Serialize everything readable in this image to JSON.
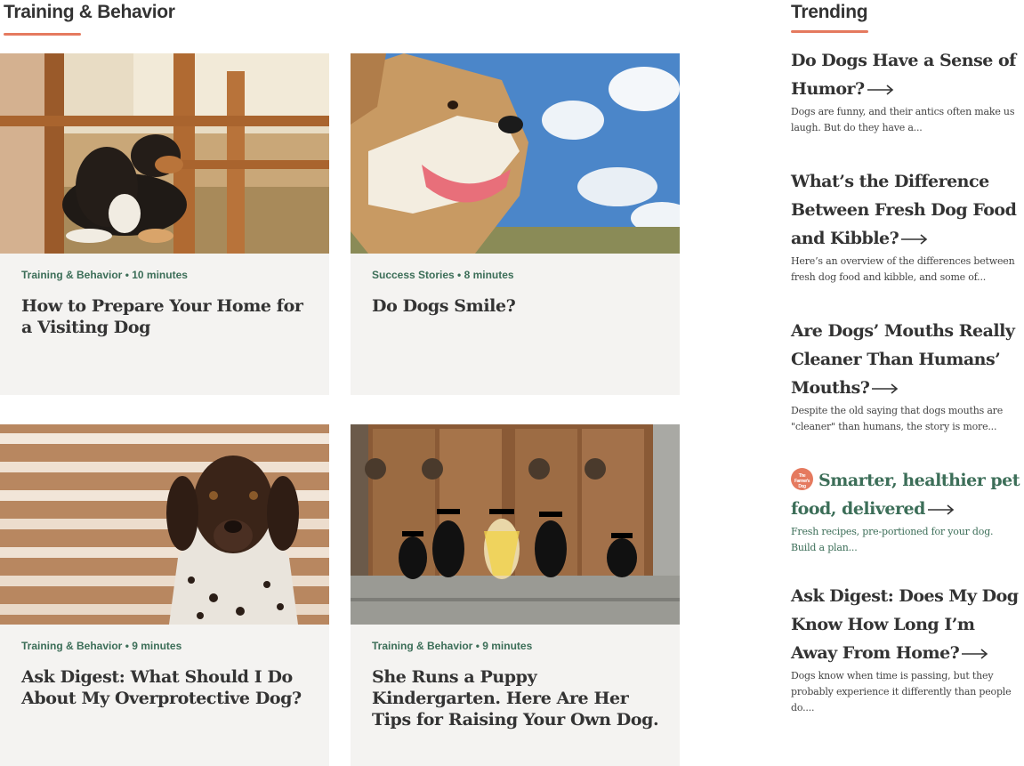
{
  "section": {
    "title": "Training & Behavior"
  },
  "colors": {
    "accent_underline": "#e57a5f",
    "category_green": "#3c6e58",
    "card_bg": "#f4f3f1",
    "heading_text": "#333333"
  },
  "cards": [
    {
      "meta": "Training & Behavior • 10 minutes",
      "headline": "How to Prepare Your Home for a Visiting Dog",
      "image": "tricolor dog lying under wooden chairs"
    },
    {
      "meta": "Success Stories • 8 minutes",
      "headline": "Do Dogs Smile?",
      "image": "terrier smiling under blue sky"
    },
    {
      "meta": "Training & Behavior • 9 minutes",
      "headline": "Ask Digest: What Should I Do About My Overprotective Dog?",
      "image": "spotted pointer in front of wooden slats"
    },
    {
      "meta": "Training & Behavior • 9 minutes",
      "headline": "She Runs a Puppy Kindergarten. Here Are Her Tips for Raising Your Own Dog.",
      "image": "puppies in graduation caps on steps"
    }
  ],
  "trending": {
    "title": "Trending",
    "items": [
      {
        "headline": "Do Dogs Have a Sense of Humor?",
        "description": "Dogs are funny, and their antics often make us laugh. But do they have a...",
        "icon": "arrow-right-icon"
      },
      {
        "headline": "What’s the Difference Between Fresh Dog Food and Kibble?",
        "description": "Here’s an overview of the differences between fresh dog food and kibble, and some of...",
        "icon": "arrow-right-icon"
      },
      {
        "headline": "Are Dogs’ Mouths Really Cleaner Than Humans’ Mouths?",
        "description": "Despite the old saying that dogs mouths are \"cleaner\" than humans, the story is more...",
        "icon": "arrow-right-icon"
      },
      {
        "headline": "Smarter, healthier pet food, delivered",
        "description": "Fresh recipes, pre-portioned for your dog. Build a plan...",
        "logo_text": "The Farmer's Dog",
        "icon": "arrow-right-icon"
      },
      {
        "headline": "Ask Digest: Does My Dog Know How Long I’m Away From Home?",
        "description": "Dogs know when time is passing, but they probably experience it differently than people do....",
        "icon": "arrow-right-icon"
      }
    ]
  }
}
